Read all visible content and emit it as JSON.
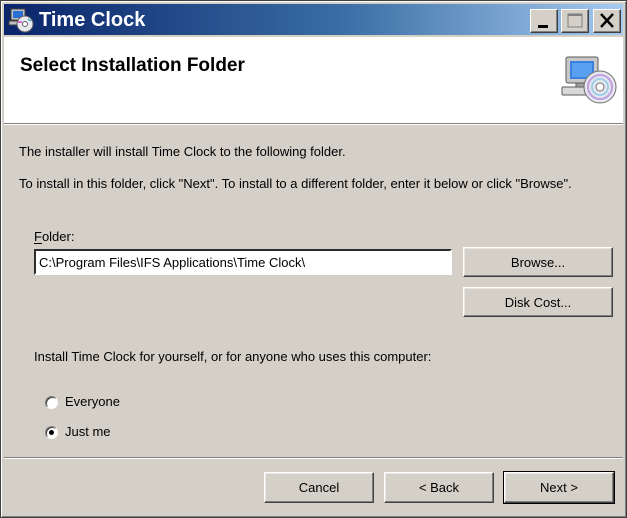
{
  "window": {
    "title": "Time Clock",
    "icons": {
      "app": "installer-cd-icon",
      "minimize": "minimize-icon",
      "maximize": "maximize-icon",
      "close": "close-icon"
    }
  },
  "banner": {
    "title": "Select Installation Folder",
    "icon": "computer-cd-icon"
  },
  "body": {
    "intro_line1": "The installer will install Time Clock to the following folder.",
    "intro_line2": "To install in this folder, click \"Next\". To install to a different folder, enter it below or click \"Browse\".",
    "folder_label": "Folder:",
    "folder_value": "C:\\Program Files\\IFS Applications\\Time Clock\\",
    "browse_label": "Browse...",
    "disk_cost_label": "Disk Cost...",
    "install_for_label": "Install Time Clock for yourself, or for anyone who uses this computer:",
    "options": [
      {
        "label": "Everyone",
        "selected": false
      },
      {
        "label": "Just me",
        "selected": true
      }
    ]
  },
  "footer": {
    "cancel_label": "Cancel",
    "back_label": "< Back",
    "next_label": "Next >"
  },
  "colors": {
    "titlebar_start": "#0a246a",
    "titlebar_end": "#a6caf0",
    "dialog_face": "#d4d0c8"
  }
}
